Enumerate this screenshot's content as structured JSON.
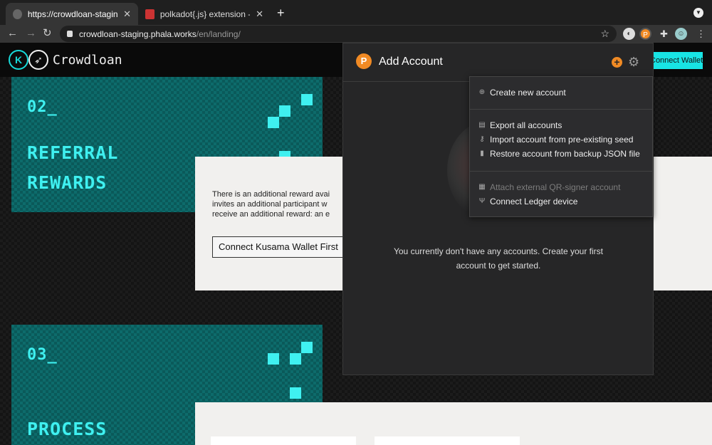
{
  "browser": {
    "tabs": [
      {
        "title": "https://crowdloan-staging.phala",
        "close": "✕"
      },
      {
        "title": "polkadot{.js} extension - Chrom",
        "close": "✕"
      }
    ],
    "new_tab": "+",
    "url_host": "crowdloan-staging.phala.works",
    "url_path": "/en/landing/"
  },
  "site": {
    "brand": "Crowdloan",
    "connect_wallet": "Connect Wallet",
    "sections": [
      {
        "number": "02_",
        "title_line1": "REFERRAL",
        "title_line2": "REWARDS"
      },
      {
        "number": "03_",
        "title_line1": "PROCESS",
        "title_line2": ""
      }
    ],
    "referral_text_line1": "There is an additional reward avai",
    "referral_text_line2": "invites an additional participant w",
    "referral_text_line3": "receive an additional reward: an e",
    "connect_kusama": "Connect Kusama Wallet First"
  },
  "extension": {
    "title": "Add Account",
    "empty_message_line1": "You currently don't have any accounts. Create your first",
    "empty_message_line2": "account to get started.",
    "menu": {
      "create": "Create new account",
      "export": "Export all accounts",
      "import_seed": "Import account from pre-existing seed",
      "restore_json": "Restore account from backup JSON file",
      "attach_qr": "Attach external QR-signer account",
      "connect_ledger": "Connect Ledger device"
    }
  },
  "colors": {
    "accent_teal": "#18e4e4",
    "polkadot_orange": "#f08a24"
  }
}
